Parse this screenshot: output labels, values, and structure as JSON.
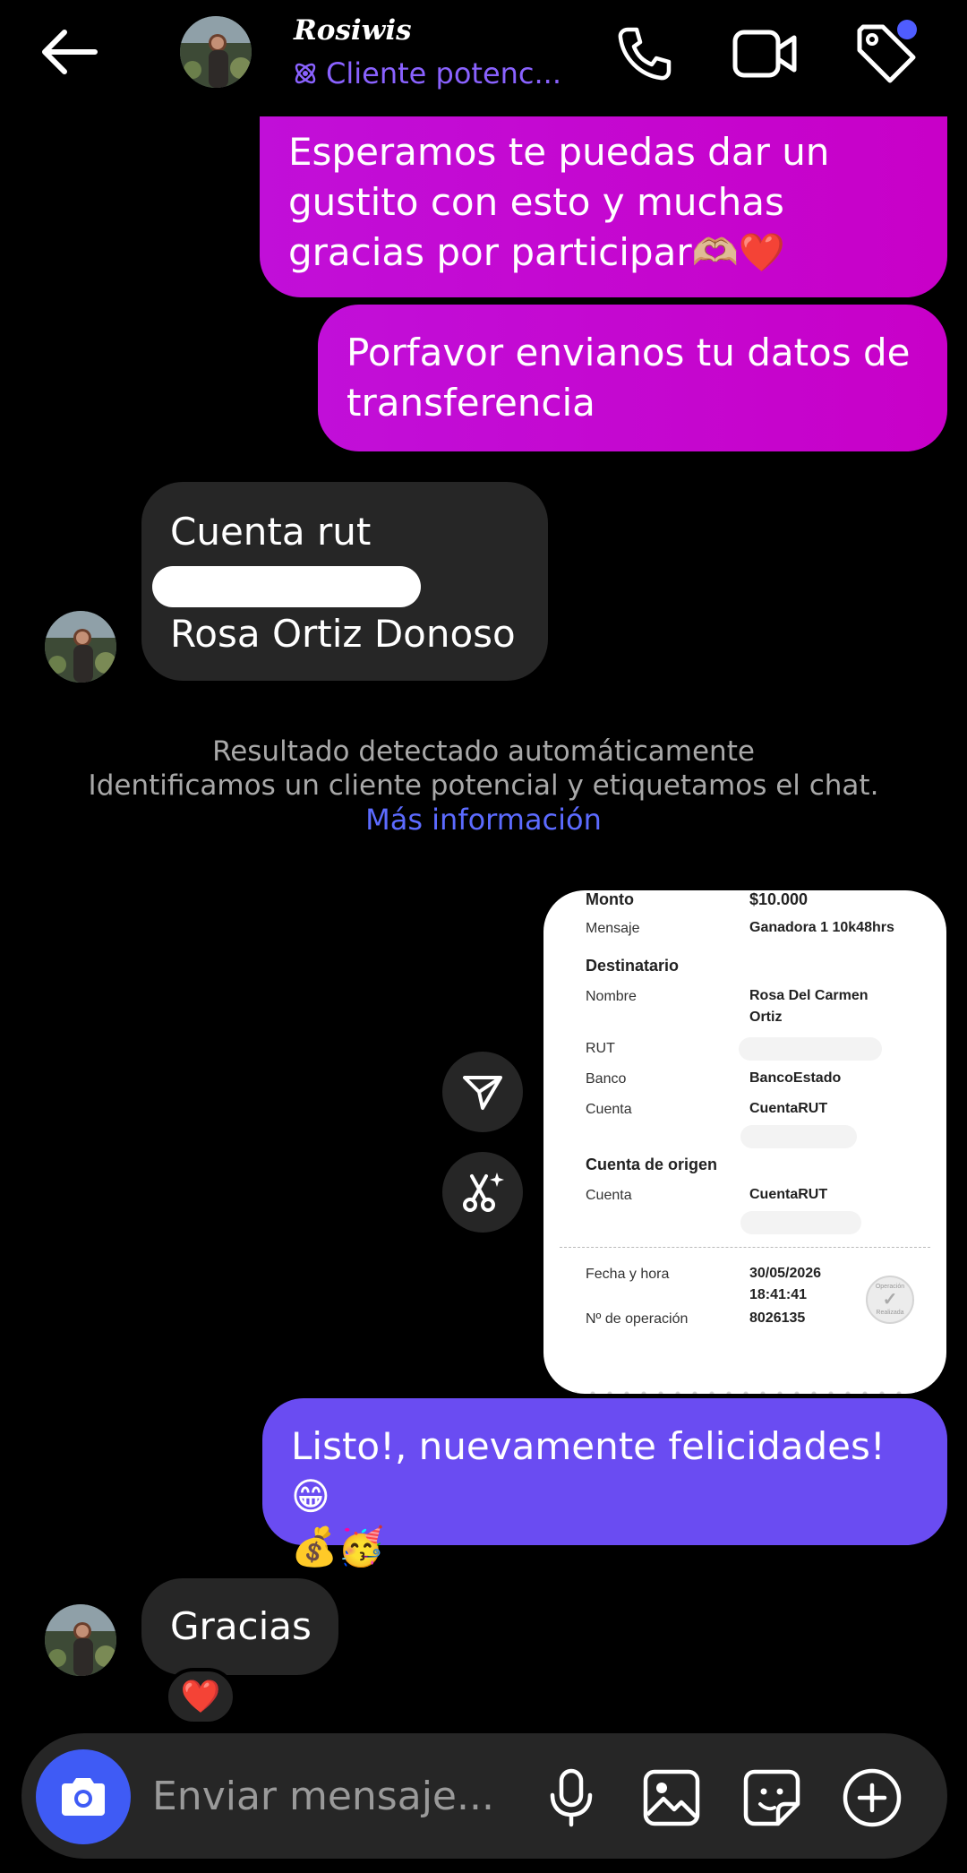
{
  "header": {
    "name": "Rosiwis",
    "label": "Cliente potenc...",
    "icons": [
      "back-arrow-icon",
      "phone-icon",
      "video-icon",
      "tag-icon"
    ],
    "notification_dot_color": "#4f5dff"
  },
  "messages": {
    "m1": [
      "Esperamos te puedas dar un",
      "gustito con esto y muchas",
      "gracias por participar🫶🏼❤️"
    ],
    "m2": [
      "Porfavor envianos tu datos de",
      "transferencia"
    ],
    "m3_line1": "Cuenta rut",
    "m3_line3": "Rosa Ortiz Donoso",
    "m5": [
      "Listo!, nuevamente felicidades!😁",
      "💰🥳"
    ],
    "m6": "Gracias",
    "reaction": "❤️"
  },
  "system_note": {
    "line1": "Resultado detectado automáticamente",
    "line2": "Identificamos un cliente potencial y etiquetamos el chat.",
    "link": "Más información"
  },
  "receipt": {
    "monto_label": "Monto",
    "monto_value": "$10.000",
    "mensaje_label": "Mensaje",
    "mensaje_value": "Ganadora 1 10k48hrs",
    "destinatario_title": "Destinatario",
    "nombre_label": "Nombre",
    "nombre_value": [
      "Rosa Del Carmen",
      "Ortiz"
    ],
    "rut_label": "RUT",
    "banco_label": "Banco",
    "banco_value": "BancoEstado",
    "cuenta_label": "Cuenta",
    "cuenta_value": "CuentaRUT",
    "origen_title": "Cuenta de origen",
    "origen_cuenta_label": "Cuenta",
    "origen_cuenta_value": "CuentaRUT",
    "fecha_label": "Fecha y hora",
    "fecha_value": [
      "30/05/2026",
      "18:41:41"
    ],
    "operacion_label": "Nº de operación",
    "operacion_value": "8026135",
    "stamp_text": [
      "Operación",
      "Realizada"
    ]
  },
  "composer": {
    "placeholder": "Enviar mensaje...",
    "icons": [
      "camera-icon",
      "microphone-icon",
      "gallery-icon",
      "sticker-icon",
      "add-icon"
    ]
  },
  "colors": {
    "pink_bubble": "#c10fd8",
    "purple_bubble": "#6a4cf2",
    "incoming_bubble": "#262626",
    "accent_label": "#8a62ff",
    "link": "#5c6bff",
    "camera_button": "#3f5bf5"
  }
}
